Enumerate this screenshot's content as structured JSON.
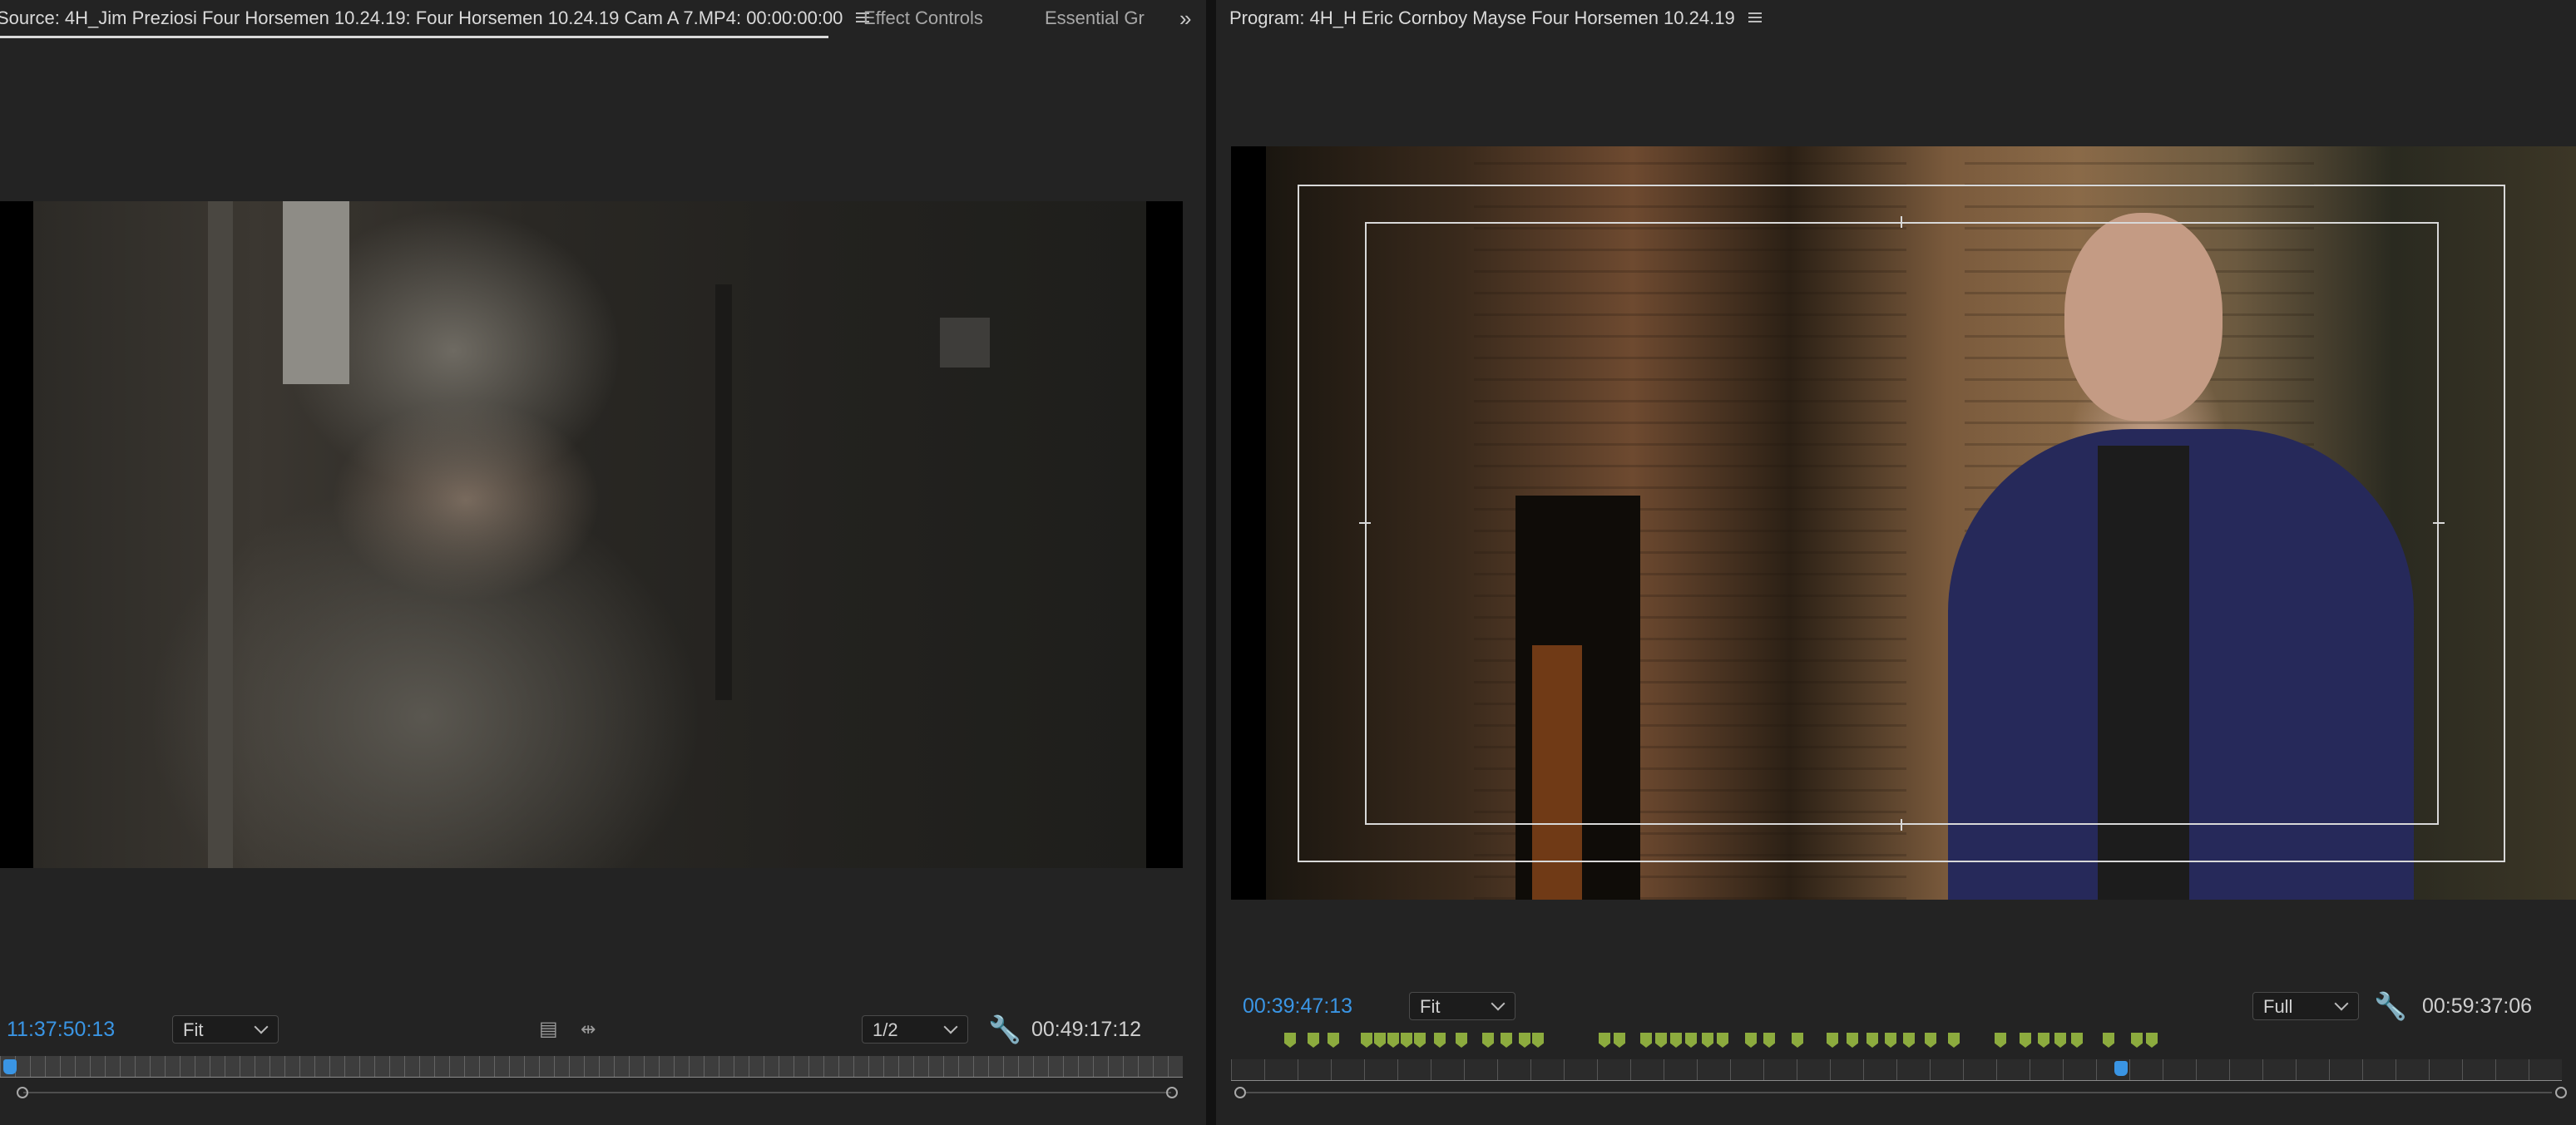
{
  "source_panel": {
    "tab_title": "Source: 4H_Jim Preziosi Four Horsemen 10.24.19: Four Horsemen 10.24.19 Cam A 7.MP4: 00:00:00:00",
    "other_tabs": [
      "Effect Controls",
      "Essential Gr"
    ],
    "overflow_icon": "double-chevron-right-icon",
    "timecode_current": "11:37:50:13",
    "zoom_select": "Fit",
    "resolution_select": "1/2",
    "timecode_duration": "00:49:17:12"
  },
  "program_panel": {
    "tab_title": "Program: 4H_H Eric Cornboy Mayse Four Horsemen 10.24.19",
    "timecode_current": "00:39:47:13",
    "zoom_select": "Fit",
    "resolution_select": "Full",
    "timecode_duration": "00:59:37:06"
  },
  "colors": {
    "panel_bg": "#232323",
    "accent_blue": "#3a95e4",
    "marker_green": "#8cab3e"
  }
}
